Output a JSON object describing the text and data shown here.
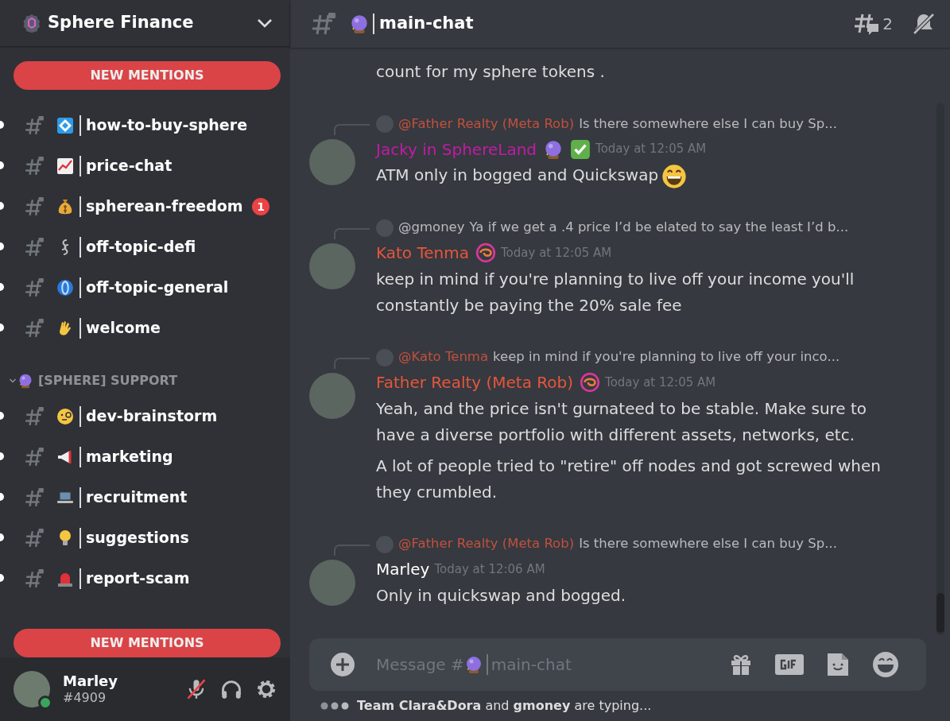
{
  "server": {
    "name": "Sphere Finance"
  },
  "mention_banners": [
    {
      "label": "NEW MENTIONS"
    },
    {
      "label": "NEW MENTIONS"
    }
  ],
  "channel_groups": [
    {
      "channels": [
        {
          "name": "how-to-buy-sphere",
          "unread": true
        },
        {
          "name": "price-chat",
          "unread": true
        },
        {
          "name": "spherean-freedom",
          "unread": true,
          "mentions": "1"
        },
        {
          "name": "off-topic-defi",
          "unread": true
        },
        {
          "name": "off-topic-general",
          "unread": true
        },
        {
          "name": "welcome",
          "unread": true
        }
      ]
    },
    {
      "name": "[SPHERE] SUPPORT",
      "expanded": true,
      "channels": [
        {
          "name": "dev-brainstorm",
          "unread": true
        },
        {
          "name": "marketing",
          "unread": true
        },
        {
          "name": "recruitment",
          "unread": true
        },
        {
          "name": "suggestions",
          "unread": true
        },
        {
          "name": "report-scam",
          "unread": true
        }
      ]
    }
  ],
  "user": {
    "name": "Marley",
    "tag": "#4909",
    "online": true,
    "mic_muted": true
  },
  "header": {
    "channel": "main-chat",
    "threads": "2"
  },
  "messages": [
    {
      "kind": "continuation",
      "paragraphs": [
        "count for my sphere tokens ."
      ]
    },
    {
      "kind": "reply",
      "reply": {
        "author": {
          "name": "@Father Realty (Meta Rob)",
          "color": "#c0503f"
        },
        "text": "Is there somewhere else I can buy Sp..."
      },
      "author": {
        "name": "Jacky in SphereLand",
        "color": "#c21ba7"
      },
      "badges": [
        {
          "kind": "crystal-ball"
        },
        {
          "kind": "check"
        }
      ],
      "time": "Today at 12:05 AM",
      "paragraphs": [
        "ATM only in bogged and Quickswap"
      ],
      "trailing_emoji": true
    },
    {
      "kind": "reply",
      "reply": {
        "author": {
          "name": "@gmoney",
          "color": "#b9bbbe"
        },
        "text": "Ya if we get a .4 price I’d be elated to say the least I’d b..."
      },
      "author": {
        "name": "Kato Tenma",
        "color": "#e8553d"
      },
      "badges": [
        {
          "kind": "swirl"
        }
      ],
      "time": "Today at 12:05 AM",
      "paragraphs": [
        "keep in mind if you're planning to live off your income you'll constantly be paying the 20% sale fee"
      ]
    },
    {
      "kind": "reply",
      "reply": {
        "author": {
          "name": "@Kato Tenma",
          "color": "#c0503f"
        },
        "text": "keep in mind if you're planning to live off your inco..."
      },
      "author": {
        "name": "Father Realty (Meta Rob)",
        "color": "#e8553d"
      },
      "badges": [
        {
          "kind": "swirl"
        }
      ],
      "time": "Today at 12:05 AM",
      "paragraphs": [
        "Yeah, and the price isn't gurnateed to be stable. Make sure to have a diverse portfolio with different assets, networks, etc.",
        "A lot of people tried to \"retire\" off nodes and got screwed when they crumbled."
      ]
    },
    {
      "kind": "reply",
      "reply": {
        "author": {
          "name": "@Father Realty (Meta Rob)",
          "color": "#c0503f"
        },
        "text": "Is there somewhere else I can buy Sp..."
      },
      "author": {
        "name": "Marley",
        "color": "#ffffff"
      },
      "time": "Today at 12:06 AM",
      "paragraphs": [
        "Only in quickswap and bogged."
      ]
    }
  ],
  "composer": {
    "placeholder_prefix": "Message #",
    "placeholder_channel": "main-chat"
  },
  "typing": "**Team Clara&Dora** and **gmoney** are typing..."
}
